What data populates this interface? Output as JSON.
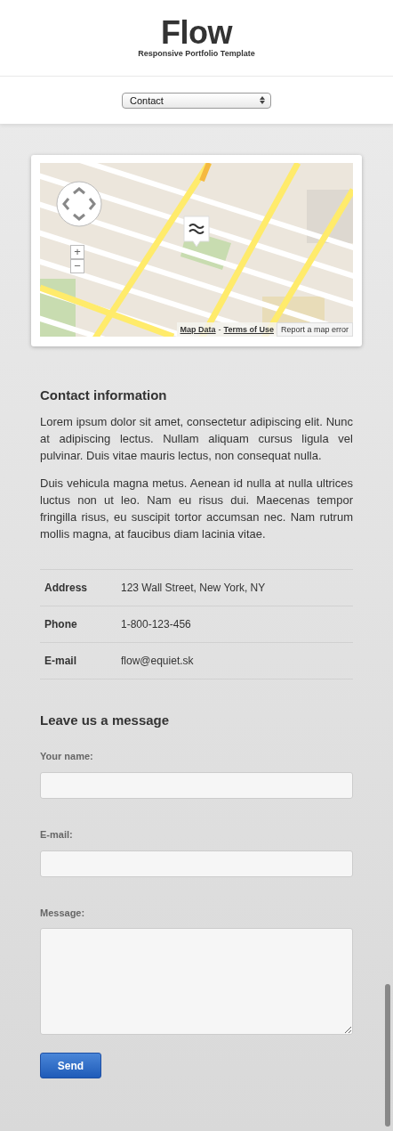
{
  "header": {
    "title": "Flow",
    "subtitle": "Responsive Portfolio Template"
  },
  "nav": {
    "value": "Contact"
  },
  "map": {
    "kind": "picture",
    "zoom_in": "+",
    "zoom_out": "−",
    "links": [
      "Map Data",
      "Terms of Use"
    ],
    "separator": "-",
    "report": "Report a map error"
  },
  "contact": {
    "heading": "Contact information",
    "paragraphs": [
      "Lorem ipsum dolor sit amet, consectetur adipiscing elit. Nunc at adipiscing lectus. Nullam aliquam cursus ligula vel pulvinar. Duis vitae mauris lectus, non consequat nulla.",
      "Duis vehicula magna metus. Aenean id nulla at nulla ultrices luctus non ut leo. Nam eu risus dui. Maecenas tempor fringilla risus, eu suscipit tortor accumsan nec. Nam rutrum mollis magna, at faucibus diam lacinia vitae."
    ],
    "details": [
      {
        "label": "Address",
        "value": "123 Wall Street, New York, NY"
      },
      {
        "label": "Phone",
        "value": "1-800-123-456"
      },
      {
        "label": "E-mail",
        "value": "flow@equiet.sk"
      }
    ]
  },
  "form": {
    "heading": "Leave us a message",
    "fields": [
      {
        "label": "Your name:",
        "kind": "text"
      },
      {
        "label": "E-mail:",
        "kind": "text"
      },
      {
        "label": "Message:",
        "kind": "textarea"
      }
    ],
    "submit": "Send"
  }
}
